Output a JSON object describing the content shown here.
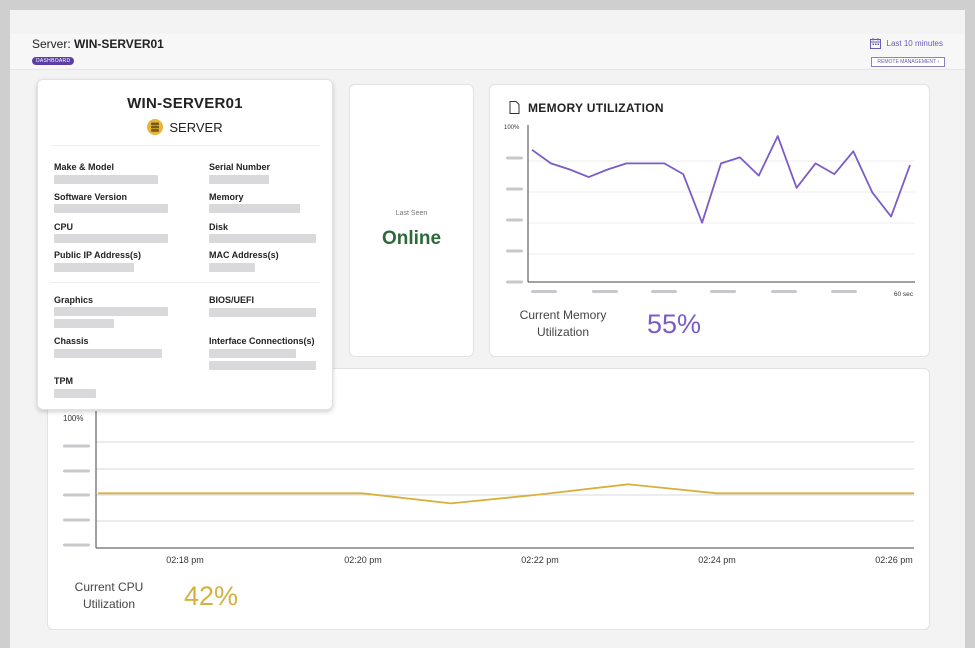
{
  "header": {
    "server_label": "Server:",
    "server_name": "WIN-SERVER01",
    "badge": "DASHBOARD",
    "time_range": "Last 10 minutes",
    "remote_button": "REMOTE MANAGEMENT"
  },
  "info_card": {
    "hostname": "WIN-SERVER01",
    "type": "SERVER",
    "fields": {
      "make_model": "Make & Model",
      "serial_number": "Serial Number",
      "software_version": "Software Version",
      "memory": "Memory",
      "cpu": "CPU",
      "disk": "Disk",
      "public_ip": "Public IP Address(s)",
      "mac_address": "MAC Address(s)",
      "graphics": "Graphics",
      "bios": "BIOS/UEFI",
      "chassis": "Chassis",
      "interface_connections": "Interface Connections(s)",
      "tpm": "TPM"
    }
  },
  "status_card": {
    "label": "Last Seen",
    "value": "Online",
    "value_color": "#2d6a3a"
  },
  "memory_card": {
    "title": "MEMORY UTILIZATION",
    "current_label": "Current Memory Utilization",
    "current_value": "55%",
    "color": "#7b5cc7"
  },
  "cpu_card": {
    "current_label": "Current CPU Utilization",
    "current_value": "42%",
    "color": "#d6b13f"
  },
  "chart_data": [
    {
      "type": "line",
      "title": "MEMORY UTILIZATION",
      "y_top_label": "100%",
      "x_end_label": "60 sec",
      "ylim": [
        0,
        100
      ],
      "x": [
        0,
        1,
        2,
        3,
        4,
        5,
        6,
        7,
        8,
        9,
        10,
        11,
        12,
        13,
        14,
        15,
        16,
        17,
        18,
        19,
        20
      ],
      "series": [
        {
          "values": [
            87,
            78,
            74,
            69,
            74,
            78,
            78,
            78,
            71,
            39,
            78,
            82,
            70,
            96,
            62,
            78,
            71,
            86,
            59,
            43,
            77
          ],
          "color": "#7b5cc7"
        }
      ],
      "grid": true
    },
    {
      "type": "line",
      "y_top_label": "100%",
      "categories": [
        "02:18 pm",
        "02:20 pm",
        "02:22 pm",
        "02:24 pm",
        "02:26 pm"
      ],
      "ylim": [
        0,
        100
      ],
      "x": [
        0,
        0.5,
        1,
        1.5,
        2,
        2.5,
        3,
        3.5,
        4
      ],
      "series": [
        {
          "values": [
            43,
            43,
            43,
            35,
            42,
            50,
            43,
            43,
            43
          ],
          "color": "#d6b13f"
        }
      ],
      "grid": true
    }
  ]
}
